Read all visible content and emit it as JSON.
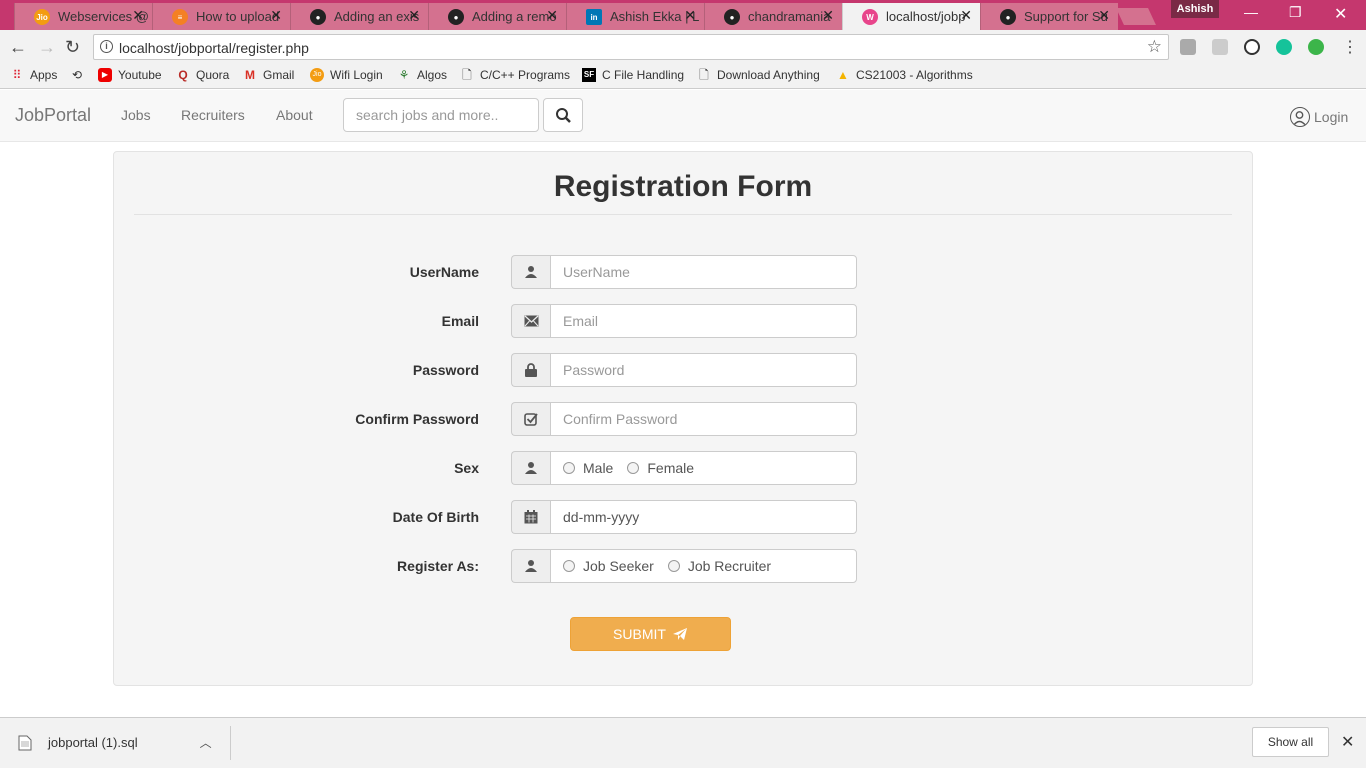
{
  "browser": {
    "tabs": [
      {
        "title": "Webservices @",
        "favicon": "jio-icon",
        "color": "#f39c12"
      },
      {
        "title": "How to upload",
        "favicon": "stackoverflow-icon",
        "color": "#f48024"
      },
      {
        "title": "Adding an exis",
        "favicon": "github-icon",
        "color": "#222222"
      },
      {
        "title": "Adding a remo",
        "favicon": "github-icon",
        "color": "#222222"
      },
      {
        "title": "Ashish Ekka | L",
        "favicon": "linkedin-icon",
        "color": "#0077b5"
      },
      {
        "title": "chandramania",
        "favicon": "github-icon",
        "color": "#222222"
      },
      {
        "title": "localhost/jobp",
        "favicon": "localhost-icon",
        "color": "#e8458b"
      },
      {
        "title": "Support for Su",
        "favicon": "github-icon",
        "color": "#222222"
      }
    ],
    "active_tab_index": 6,
    "profile_name": "Ashish",
    "url": "localhost/jobportal/register.php"
  },
  "bookmarks": [
    {
      "label": "Apps",
      "icon": "apps-grid-icon"
    },
    {
      "label": "",
      "icon": "history-icon"
    },
    {
      "label": "Youtube",
      "icon": "youtube-icon"
    },
    {
      "label": "Quora",
      "icon": "quora-icon"
    },
    {
      "label": "Gmail",
      "icon": "gmail-icon"
    },
    {
      "label": "Wifi Login",
      "icon": "jio-icon"
    },
    {
      "label": "Algos",
      "icon": "algos-icon"
    },
    {
      "label": "C/C++ Programs",
      "icon": "page-icon"
    },
    {
      "label": "C File Handling",
      "icon": "sf-icon"
    },
    {
      "label": "Download Anything",
      "icon": "page-icon"
    },
    {
      "label": "CS21003 - Algorithms",
      "icon": "drive-icon"
    }
  ],
  "navbar": {
    "brand": "JobPortal",
    "links": [
      "Jobs",
      "Recruiters",
      "About"
    ],
    "search_placeholder": "search jobs and more..",
    "login_label": "Login"
  },
  "form": {
    "title": "Registration Form",
    "fields": [
      {
        "label": "UserName",
        "placeholder": "UserName",
        "icon": "user-icon"
      },
      {
        "label": "Email",
        "placeholder": "Email",
        "icon": "envelope-icon"
      },
      {
        "label": "Password",
        "placeholder": "Password",
        "icon": "lock-icon"
      },
      {
        "label": "Confirm Password",
        "placeholder": "Confirm Password",
        "icon": "check-square-icon"
      }
    ],
    "sex": {
      "label": "Sex",
      "options": [
        "Male",
        "Female"
      ]
    },
    "dob": {
      "label": "Date Of Birth",
      "value": "dd-mm-yyyy"
    },
    "register_as": {
      "label": "Register As:",
      "options": [
        "Job Seeker",
        "Job Recruiter"
      ]
    },
    "submit_label": "SUBMIT"
  },
  "downloads": {
    "file_name": "jobportal (1).sql",
    "show_all_label": "Show all"
  },
  "colors": {
    "chrome_frame": "#c5376e",
    "submit_button": "#f0ad4e",
    "panel_background": "#f5f5f5"
  }
}
